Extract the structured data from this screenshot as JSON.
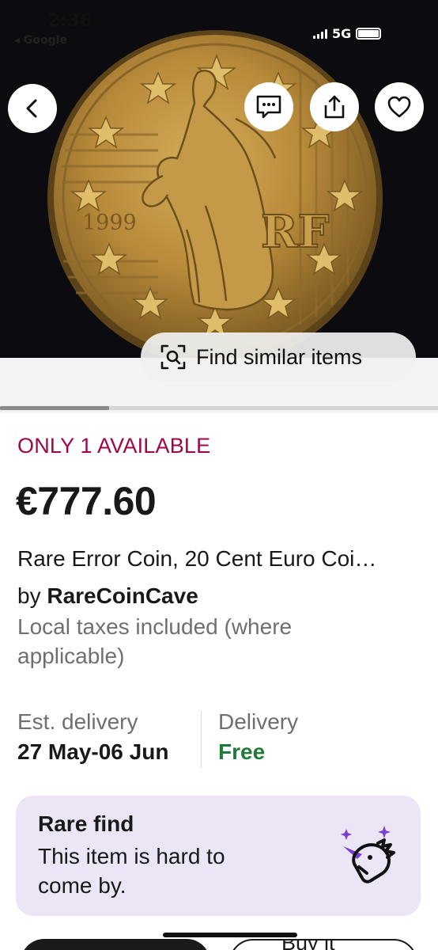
{
  "status_bar": {
    "time": "2:36",
    "back_app": "◂ Google",
    "network": "5G"
  },
  "coin_image": {
    "year": "1999",
    "initials": "RF"
  },
  "image_overlay": {
    "find_similar_label": "Find similar items"
  },
  "listing": {
    "availability": "ONLY 1 AVAILABLE",
    "price": "€777.60",
    "title": "Rare Error Coin, 20 Cent Euro Coi…",
    "seller_prefix": "by ",
    "seller_name": "RareCoinCave",
    "taxes_note": "Local taxes included (where applicable)"
  },
  "delivery": {
    "est_label": "Est. delivery",
    "est_value": "27 May-06 Jun",
    "delivery_label": "Delivery",
    "delivery_value": "Free"
  },
  "rare_find": {
    "title": "Rare find",
    "text": "This item is hard to come by."
  },
  "actions": {
    "buy_label": "Buy it"
  },
  "colors": {
    "availability": "#a0064a",
    "free": "#1f7a3a",
    "rare_card_bg": "#ebe5f6"
  }
}
